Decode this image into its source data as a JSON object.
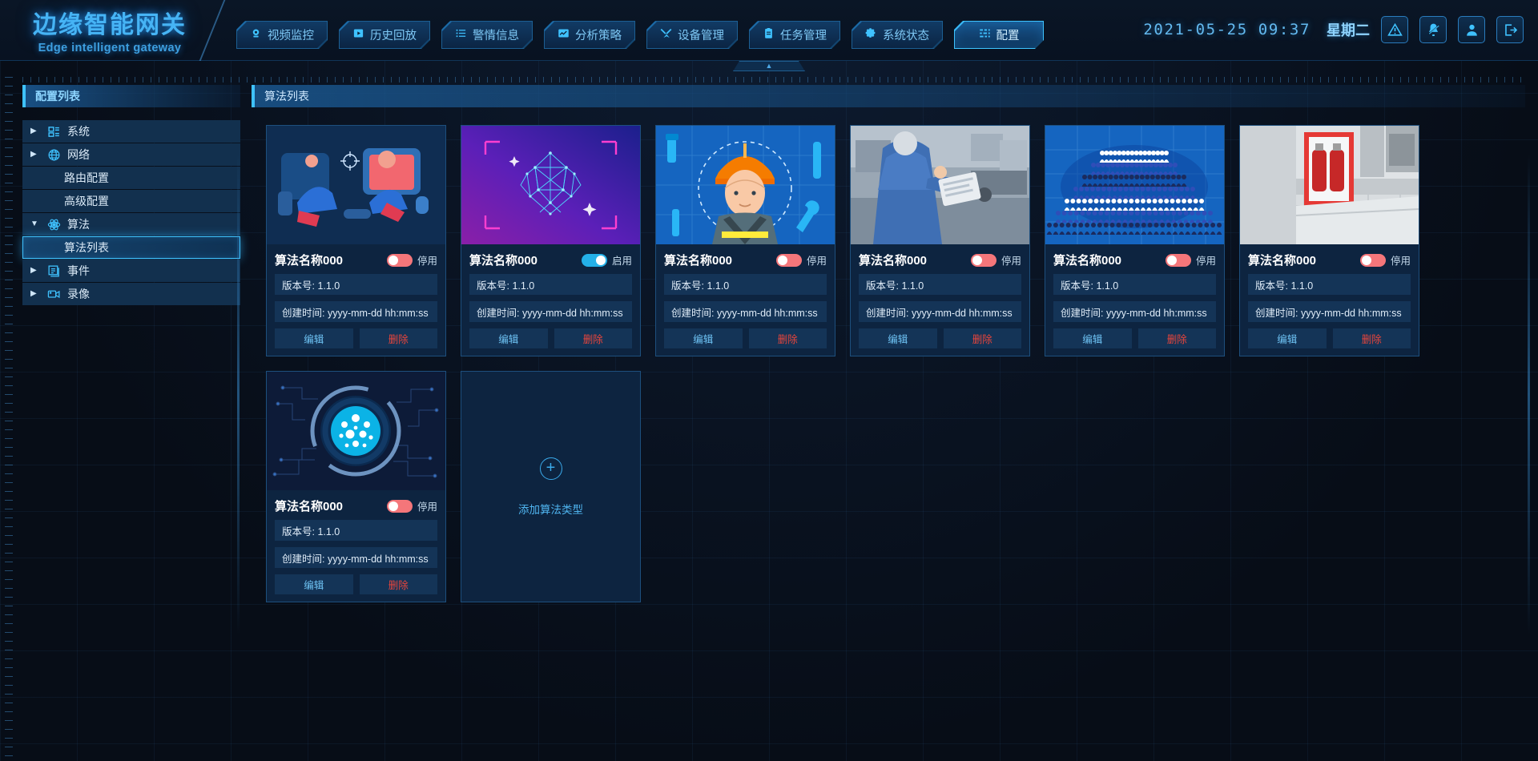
{
  "brand": {
    "cn": "边缘智能网关",
    "en": "Edge intelligent gateway"
  },
  "header": {
    "tabs": [
      {
        "label": "视频监控",
        "icon": "camera-icon",
        "active": false
      },
      {
        "label": "历史回放",
        "icon": "play-box-icon",
        "active": false
      },
      {
        "label": "警情信息",
        "icon": "list-icon",
        "active": false
      },
      {
        "label": "分析策略",
        "icon": "chart-icon",
        "active": false
      },
      {
        "label": "设备管理",
        "icon": "tools-icon",
        "active": false
      },
      {
        "label": "任务管理",
        "icon": "clipboard-icon",
        "active": false
      },
      {
        "label": "系统状态",
        "icon": "gear-icon",
        "active": false
      },
      {
        "label": "配置",
        "icon": "sliders-icon",
        "active": true
      }
    ],
    "datetime": "2021-05-25  09:37",
    "weekday": "星期二",
    "icons": [
      "warning-icon",
      "bell-muted-icon",
      "user-icon",
      "logout-icon"
    ]
  },
  "sidebar": {
    "title": "配置列表",
    "items": [
      {
        "label": "系统",
        "icon": "system-icon",
        "caret": "▶",
        "level": 0,
        "selected": false
      },
      {
        "label": "网络",
        "icon": "globe-icon",
        "caret": "▶",
        "level": 0,
        "selected": false
      },
      {
        "label": "路由配置",
        "icon": "",
        "caret": "",
        "level": 1,
        "selected": false
      },
      {
        "label": "高级配置",
        "icon": "",
        "caret": "",
        "level": 1,
        "selected": false
      },
      {
        "label": "算法",
        "icon": "atom-icon",
        "caret": "▼",
        "level": 0,
        "selected": false
      },
      {
        "label": "算法列表",
        "icon": "",
        "caret": "",
        "level": 1,
        "selected": true
      },
      {
        "label": "事件",
        "icon": "event-icon",
        "caret": "▶",
        "level": 0,
        "selected": false
      },
      {
        "label": "录像",
        "icon": "video-icon",
        "caret": "▶",
        "level": 0,
        "selected": false
      }
    ]
  },
  "main": {
    "title": "算法列表",
    "labels": {
      "version_prefix": "版本号:",
      "created_prefix": "创建时间:",
      "edit": "编辑",
      "delete": "删除",
      "enabled": "启用",
      "disabled": "停用"
    },
    "add_card": {
      "label": "添加算法类型",
      "icon": "plus-circle-icon"
    },
    "cards": [
      {
        "name": "算法名称000",
        "version": "版本号: 1.1.0",
        "created": "创建时间: yyyy-mm-dd  hh:mm:ss",
        "state": "停用",
        "enabled": false,
        "thumb": "illustration-persons",
        "edit": "编辑",
        "delete": "删除"
      },
      {
        "name": "算法名称000",
        "version": "版本号: 1.1.0",
        "created": "创建时间: yyyy-mm-dd  hh:mm:ss",
        "state": "启用",
        "enabled": true,
        "thumb": "face-mesh",
        "edit": "编辑",
        "delete": "删除"
      },
      {
        "name": "算法名称000",
        "version": "版本号: 1.1.0",
        "created": "创建时间: yyyy-mm-dd  hh:mm:ss",
        "state": "停用",
        "enabled": false,
        "thumb": "helmet-worker",
        "edit": "编辑",
        "delete": "删除"
      },
      {
        "name": "算法名称000",
        "version": "版本号: 1.1.0",
        "created": "创建时间: yyyy-mm-dd  hh:mm:ss",
        "state": "停用",
        "enabled": false,
        "thumb": "inspector-photo",
        "edit": "编辑",
        "delete": "删除"
      },
      {
        "name": "算法名称000",
        "version": "版本号: 1.1.0",
        "created": "创建时间: yyyy-mm-dd  hh:mm:ss",
        "state": "停用",
        "enabled": false,
        "thumb": "crowd",
        "edit": "编辑",
        "delete": "删除"
      },
      {
        "name": "算法名称000",
        "version": "版本号: 1.1.0",
        "created": "创建时间: yyyy-mm-dd  hh:mm:ss",
        "state": "停用",
        "enabled": false,
        "thumb": "fire-extinguisher",
        "edit": "编辑",
        "delete": "删除"
      },
      {
        "name": "算法名称000",
        "version": "版本号: 1.1.0",
        "created": "创建时间: yyyy-mm-dd  hh:mm:ss",
        "state": "停用",
        "enabled": false,
        "thumb": "ai-brain",
        "edit": "编辑",
        "delete": "删除"
      }
    ]
  },
  "colors": {
    "accent": "#3fc2ff",
    "bg": "#070d17",
    "card_bg": "#0d2440",
    "toggle_off": "#f4767a",
    "toggle_on": "#24b0e8",
    "danger": "#e8453c"
  }
}
